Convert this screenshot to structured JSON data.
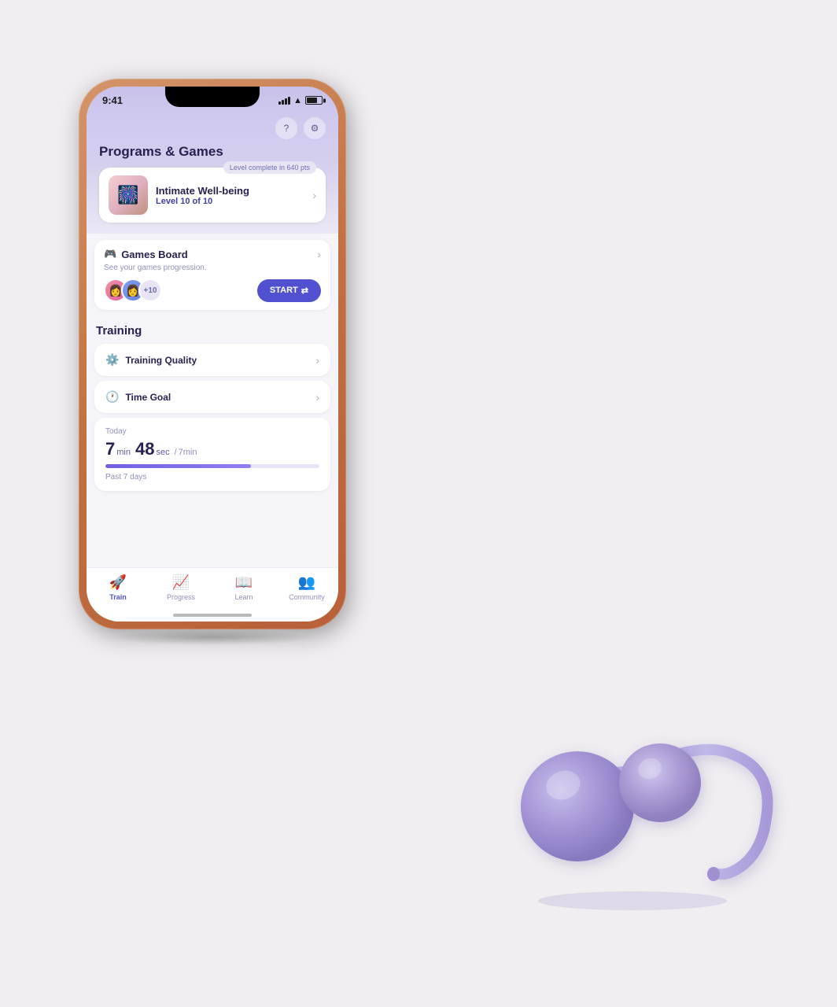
{
  "scene": {
    "background": "#f0eef0"
  },
  "phone": {
    "status_bar": {
      "time": "9:41",
      "signal": "●●●●",
      "wifi": "wifi",
      "battery": "battery"
    },
    "header": {
      "title": "Programs & Games",
      "help_icon": "?",
      "settings_icon": "⚙"
    },
    "program_card": {
      "level_badge": "Level complete in 640 pts",
      "name": "Intimate Well-being",
      "level_text": "Level",
      "level_num": "10",
      "level_of": "of 10"
    },
    "games_board": {
      "title": "Games Board",
      "subtitle": "See your games progression.",
      "avatar_count": "+10",
      "start_label": "START"
    },
    "training": {
      "section_title": "Training",
      "quality_label": "Training Quality",
      "time_goal_label": "Time Goal",
      "today_label": "Today",
      "time_big": "7",
      "time_min": "min",
      "time_sec": "48",
      "time_sec_unit": "sec",
      "time_goal": "7min",
      "past_days_label": "Past 7 days",
      "progress_percent": 68
    },
    "bottom_nav": {
      "items": [
        {
          "label": "Train",
          "icon": "🚀",
          "active": true
        },
        {
          "label": "Progress",
          "icon": "📈",
          "active": false
        },
        {
          "label": "Learn",
          "icon": "📖",
          "active": false
        },
        {
          "label": "Community",
          "icon": "👥",
          "active": false
        }
      ]
    }
  }
}
